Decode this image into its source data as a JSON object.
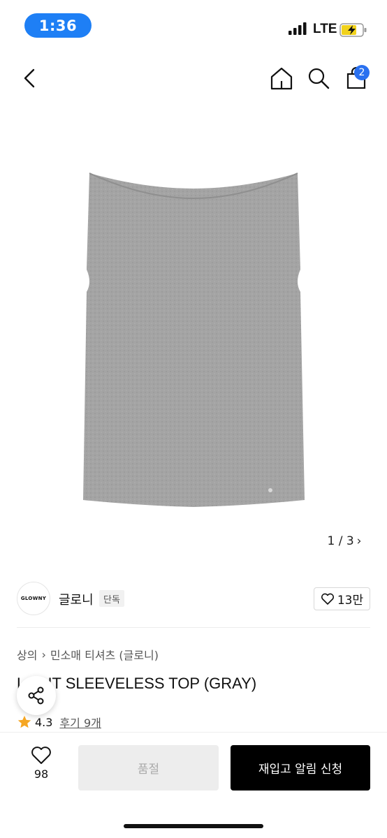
{
  "status_bar": {
    "time": "1:36",
    "network": "LTE"
  },
  "header": {
    "cart_count": "2"
  },
  "product_image": {
    "pager_text": "1 / 3",
    "pager_arrow": "›"
  },
  "brand": {
    "logo_text": "GLOWNY",
    "name": "글로니",
    "tag": "단독",
    "likes": "13만"
  },
  "breadcrumb": {
    "category": "상의",
    "separator": "›",
    "subcategory": "민소매 티셔츠 (글로니)"
  },
  "product": {
    "title": "L    SLIT SLEEVELESS TOP (GRAY)",
    "rating": "4.3",
    "reviews": "후기 9개"
  },
  "bottom_bar": {
    "wish_count": "98",
    "soldout_label": "품절",
    "restock_label": "재입고 알림 신청"
  },
  "colors": {
    "time_pill": "#1e7ff5",
    "badge": "#2a71f0",
    "star": "#f5a623",
    "primary_button": "#000000"
  }
}
